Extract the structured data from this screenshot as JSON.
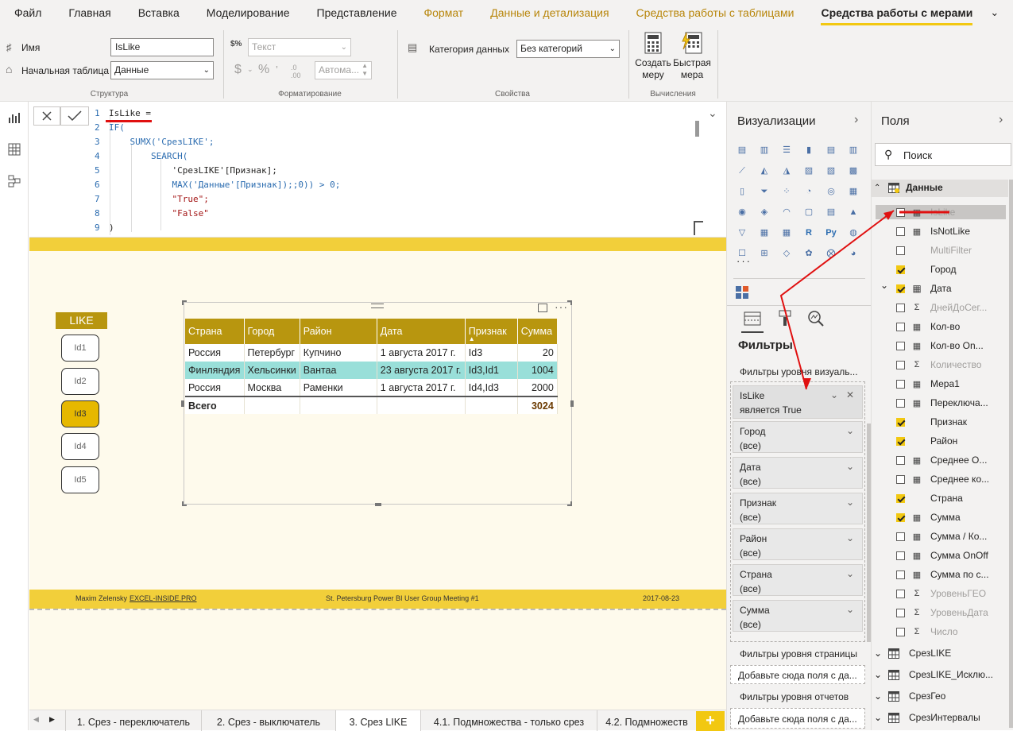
{
  "menu": [
    "Файл",
    "Главная",
    "Вставка",
    "Моделирование",
    "Представление",
    "Формат",
    "Данные и детализация",
    "Средства работы с таблицами",
    "Средства работы с мерами"
  ],
  "ribbon": {
    "name_label": "Имя",
    "name_value": "IsLike",
    "home_table_label": "Начальная таблица",
    "home_table_value": "Данные",
    "group_structure": "Структура",
    "format_value": "Текст",
    "auto_value": "Автома...",
    "group_format": "Форматирование",
    "data_category_label": "Категория данных",
    "data_category_value": "Без категорий",
    "group_properties": "Свойства",
    "new_measure": "Создать\nмеру",
    "quick_measure": "Быстрая\nмера",
    "group_calc": "Вычисления"
  },
  "formula": {
    "lines": [
      {
        "n": "1",
        "t": "IsLike ="
      },
      {
        "n": "2",
        "t": "IF("
      },
      {
        "n": "3",
        "t": "    SUMX('СрезLIKE';"
      },
      {
        "n": "4",
        "t": "        SEARCH("
      },
      {
        "n": "5",
        "t": "            'СрезLIKE'[Признак];"
      },
      {
        "n": "6",
        "t": "            MAX('Данные'[Признак]);;0)) > 0;"
      },
      {
        "n": "7",
        "t": "            \"True\";"
      },
      {
        "n": "8",
        "t": "            \"False\""
      },
      {
        "n": "9",
        "t": ")"
      }
    ]
  },
  "slicer": {
    "title": "LIKE",
    "items": [
      "Id1",
      "Id2",
      "Id3",
      "Id4",
      "Id5"
    ],
    "selected": "Id3"
  },
  "table": {
    "headers": [
      "Страна",
      "Город",
      "Район",
      "Дата",
      "Признак",
      "Сумма"
    ],
    "rows": [
      [
        "Россия",
        "Петербург",
        "Купчино",
        "1 августа 2017 г.",
        "Id3",
        "20"
      ],
      [
        "Финляндия",
        "Хельсинки",
        "Вантаа",
        "23 августа 2017 г.",
        "Id3,Id1",
        "1004"
      ],
      [
        "Россия",
        "Москва",
        "Раменки",
        "1 августа 2017 г.",
        "Id4,Id3",
        "2000"
      ]
    ],
    "total_label": "Всего",
    "total_value": "3024"
  },
  "footer": {
    "author": "Maxim Zelensky",
    "site": "EXCEL-INSIDE.PRO",
    "event": "St. Petersburg Power BI User Group Meeting #1",
    "date": "2017-08-23"
  },
  "viz": {
    "title": "Визуализации",
    "filters_title": "Фильтры",
    "visual_level": "Фильтры уровня визуаль...",
    "page_level": "Фильтры уровня страницы",
    "report_level": "Фильтры уровня отчетов",
    "add_fields": "Добавьте сюда поля с да...",
    "filter_cards": [
      {
        "name": "IsLike",
        "value": "является True"
      },
      {
        "name": "Город",
        "value": "(все)"
      },
      {
        "name": "Дата",
        "value": "(все)"
      },
      {
        "name": "Признак",
        "value": "(все)"
      },
      {
        "name": "Район",
        "value": "(все)"
      },
      {
        "name": "Страна",
        "value": "(все)"
      },
      {
        "name": "Сумма",
        "value": "(все)"
      }
    ]
  },
  "fields": {
    "title": "Поля",
    "search_placeholder": "Поиск",
    "table_name": "Данные",
    "items": [
      {
        "label": "IsLike",
        "type": "measure",
        "checked": false,
        "dim": true
      },
      {
        "label": "IsNotLike",
        "type": "measure",
        "checked": false,
        "dim": false
      },
      {
        "label": "MultiFilter",
        "type": "none",
        "checked": false,
        "dim": true
      },
      {
        "label": "Город",
        "type": "none",
        "checked": true,
        "dim": false
      },
      {
        "label": "Дата",
        "type": "calendar",
        "checked": true,
        "dim": false
      },
      {
        "label": "ДнейДоСег...",
        "type": "sigma",
        "checked": false,
        "dim": true
      },
      {
        "label": "Кол-во",
        "type": "measure",
        "checked": false,
        "dim": false
      },
      {
        "label": "Кол-во On...",
        "type": "measure",
        "checked": false,
        "dim": false
      },
      {
        "label": "Количество",
        "type": "sigma",
        "checked": false,
        "dim": true
      },
      {
        "label": "Мера1",
        "type": "measure",
        "checked": false,
        "dim": false
      },
      {
        "label": "Переключа...",
        "type": "measure",
        "checked": false,
        "dim": false
      },
      {
        "label": "Признак",
        "type": "none",
        "checked": true,
        "dim": false
      },
      {
        "label": "Район",
        "type": "none",
        "checked": true,
        "dim": false
      },
      {
        "label": "Среднее О...",
        "type": "measure",
        "checked": false,
        "dim": false
      },
      {
        "label": "Среднее ко...",
        "type": "measure",
        "checked": false,
        "dim": false
      },
      {
        "label": "Страна",
        "type": "none",
        "checked": true,
        "dim": false
      },
      {
        "label": "Сумма",
        "type": "measure",
        "checked": true,
        "dim": false
      },
      {
        "label": "Сумма / Ко...",
        "type": "measure",
        "checked": false,
        "dim": false
      },
      {
        "label": "Сумма OnOff",
        "type": "measure",
        "checked": false,
        "dim": false
      },
      {
        "label": "Сумма по с...",
        "type": "measure",
        "checked": false,
        "dim": false
      },
      {
        "label": "УровеньГЕО",
        "type": "sigma",
        "checked": false,
        "dim": true
      },
      {
        "label": "УровеньДата",
        "type": "sigma",
        "checked": false,
        "dim": true
      },
      {
        "label": "Число",
        "type": "sigma",
        "checked": false,
        "dim": true
      }
    ],
    "other_tables": [
      "СрезLIKE",
      "СрезLIKE_Исклю...",
      "СрезГео",
      "СрезИнтервалы"
    ]
  },
  "tabs": [
    "1. Срез - переключатель",
    "2. Срез - выключатель",
    "3. Срез LIKE",
    "4.1. Подмножества - только срез",
    "4.2. Подмножеств"
  ],
  "active_tab": "3. Срез LIKE",
  "colors": {
    "accent": "#f2c811",
    "header": "#b8960f",
    "highlight_row": "#99dfd9",
    "arrow": "#e01010"
  }
}
